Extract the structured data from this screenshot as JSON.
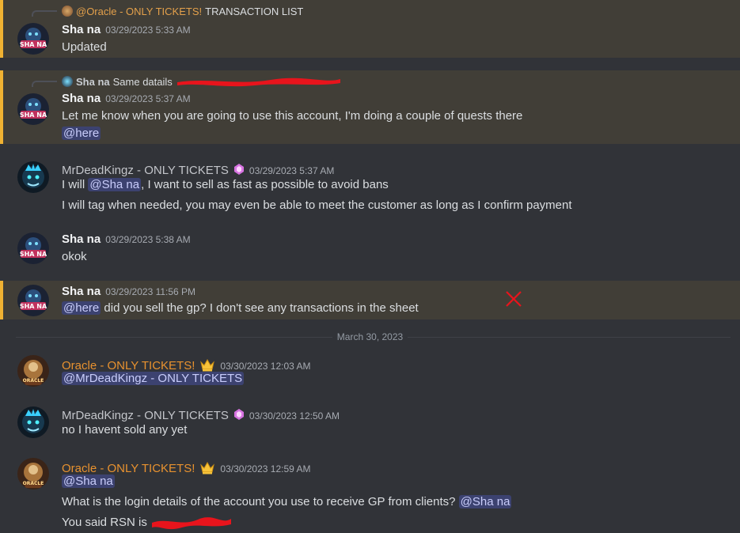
{
  "messages": [
    {
      "reply": {
        "author": "@Oracle - ONLY TICKETS!",
        "text": "TRANSACTION LIST"
      },
      "author": "Sha na",
      "timestamp": "03/29/2023 5:33 AM",
      "lines": [
        "Updated"
      ]
    },
    {
      "reply": {
        "author": "Sha na",
        "text": "Same datails"
      },
      "author": "Sha na",
      "timestamp": "03/29/2023 5:37 AM",
      "lines": [
        "Let me know when you are going to use this account, I'm doing a couple of quests there"
      ],
      "mention_line": "@here"
    },
    {
      "author": "MrDeadKingz - ONLY TICKETS",
      "timestamp": "03/29/2023 5:37 AM",
      "line1_pre": "I will ",
      "line1_mention": "@Sha na",
      "line1_post": ", I want to sell as fast as possible to avoid bans",
      "line2": "I will tag when needed, you may even be able to meet the customer as long as I confirm payment"
    },
    {
      "author": "Sha na",
      "timestamp": "03/29/2023 5:38 AM",
      "lines": [
        "okok"
      ]
    },
    {
      "author": "Sha na",
      "timestamp": "03/29/2023 11:56 PM",
      "mention": "@here",
      "text": " did you sell the gp? I don't see any transactions in the sheet"
    },
    {
      "author": "Oracle - ONLY TICKETS!",
      "timestamp": "03/30/2023 12:03 AM",
      "mention": "@MrDeadKingz - ONLY TICKETS"
    },
    {
      "author": "MrDeadKingz - ONLY TICKETS",
      "timestamp": "03/30/2023 12:50 AM",
      "lines": [
        "no I havent sold any yet"
      ]
    },
    {
      "author": "Oracle - ONLY TICKETS!",
      "timestamp": "03/30/2023 12:59 AM",
      "mention": "@Sha na",
      "line2_text": "What is the login details of the account you use to receive GP from clients? ",
      "line2_mention": "@Sha na",
      "line3_text": "You said RSN is "
    }
  ],
  "date_divider": "March 30, 2023",
  "colors": {
    "highlight_bg": "#413e37",
    "highlight_bar": "#f0b232",
    "mention_bg": "#3c4270",
    "oracle_name": "#e8922f"
  }
}
